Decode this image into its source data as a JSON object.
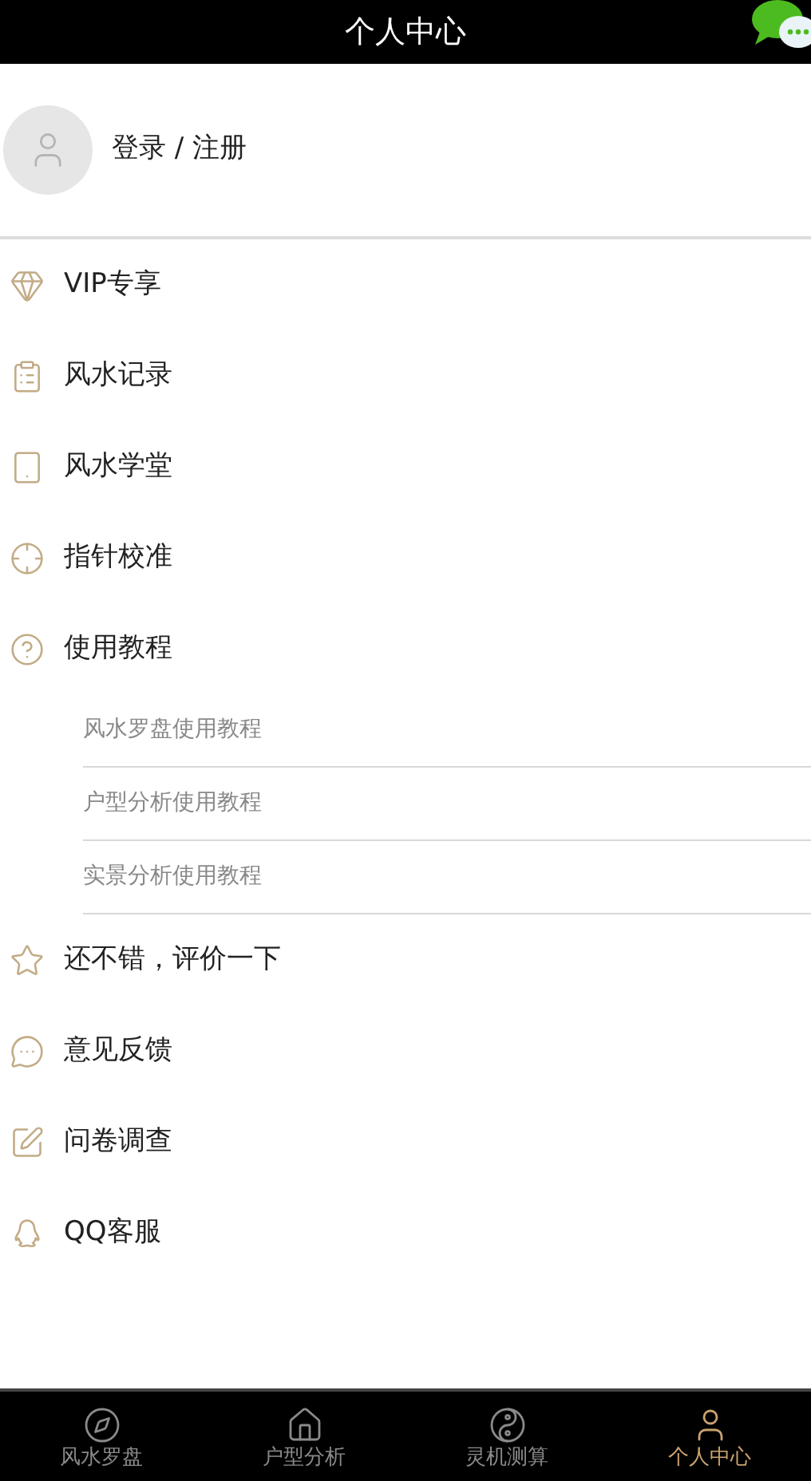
{
  "header": {
    "title": "个人中心"
  },
  "profile": {
    "login_label": "登录 / 注册"
  },
  "menu": [
    {
      "kind": "item",
      "label": "VIP专享"
    },
    {
      "kind": "item",
      "label": "风水记录"
    },
    {
      "kind": "item",
      "label": "风水学堂"
    },
    {
      "kind": "item",
      "label": "指针校准"
    },
    {
      "kind": "item",
      "label": "使用教程"
    },
    {
      "kind": "subitem",
      "label": "风水罗盘使用教程"
    },
    {
      "kind": "subitem",
      "label": "户型分析使用教程"
    },
    {
      "kind": "subitem",
      "label": "实景分析使用教程"
    },
    {
      "kind": "item",
      "label": "还不错，评价一下"
    },
    {
      "kind": "item",
      "label": "意见反馈"
    },
    {
      "kind": "item",
      "label": "问卷调查"
    },
    {
      "kind": "item",
      "label": "QQ客服"
    }
  ],
  "tab_bar": [
    {
      "label": "风水罗盘",
      "selected": false
    },
    {
      "label": "户型分析",
      "selected": false
    },
    {
      "label": "灵机测算",
      "selected": false
    },
    {
      "label": "个人中心",
      "selected": true
    }
  ]
}
